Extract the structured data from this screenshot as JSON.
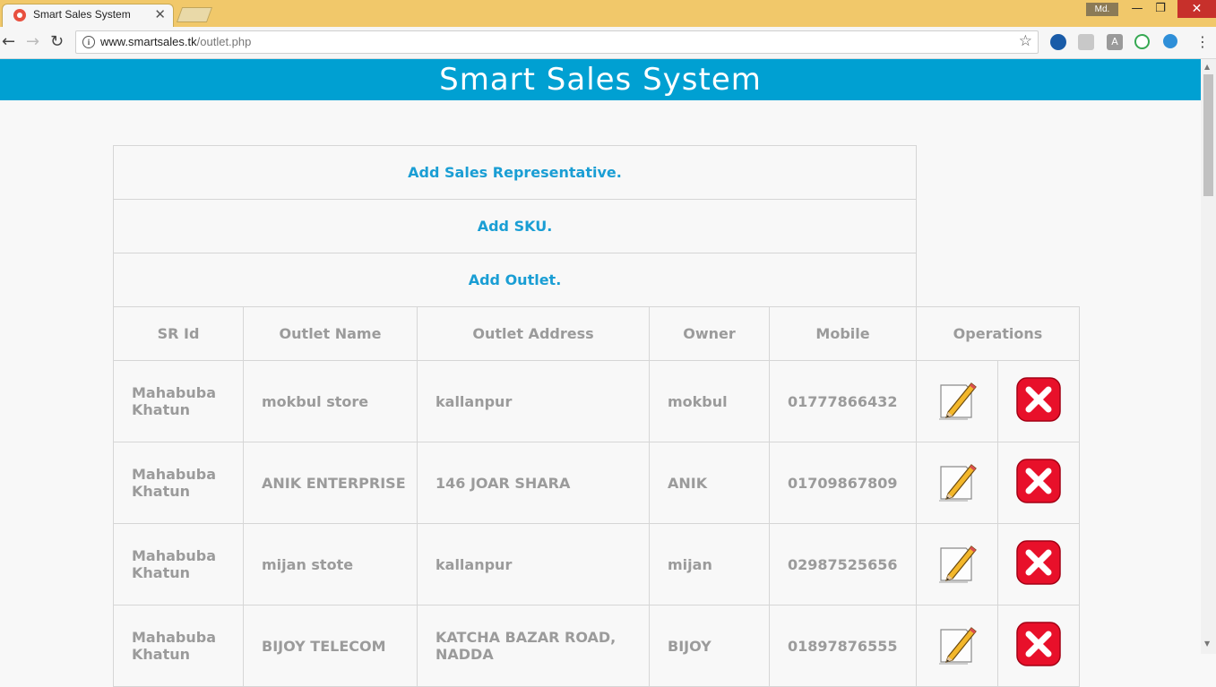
{
  "browser": {
    "tab_title": "Smart Sales System",
    "tab_close": "✕",
    "profile_label": "Md.",
    "url_host": "www.smartsales.tk",
    "url_path": "/outlet.php"
  },
  "page": {
    "header_title": "Smart Sales System",
    "links": [
      "Add Sales Representative.",
      "Add SKU.",
      "Add Outlet."
    ],
    "columns": [
      "SR Id",
      "Outlet Name",
      "Outlet Address",
      "Owner",
      "Mobile",
      "Operations"
    ],
    "rows": [
      {
        "sr": "Mahabuba Khatun",
        "name": "mokbul store",
        "address": "kallanpur",
        "owner": "mokbul",
        "mobile": "01777866432"
      },
      {
        "sr": "Mahabuba Khatun",
        "name": "ANIK ENTERPRISE",
        "address": "146 JOAR SHARA",
        "owner": "ANIK",
        "mobile": "01709867809"
      },
      {
        "sr": "Mahabuba Khatun",
        "name": "mijan stote",
        "address": "kallanpur",
        "owner": "mijan",
        "mobile": "02987525656"
      },
      {
        "sr": "Mahabuba Khatun",
        "name": "BIJOY TELECOM",
        "address": "KATCHA BAZAR ROAD, NADDA",
        "owner": "BIJOY",
        "mobile": "01897876555"
      }
    ]
  },
  "colors": {
    "header_bg": "#00a0d2",
    "link": "#1a9ed4",
    "delete_red": "#e8102a"
  }
}
